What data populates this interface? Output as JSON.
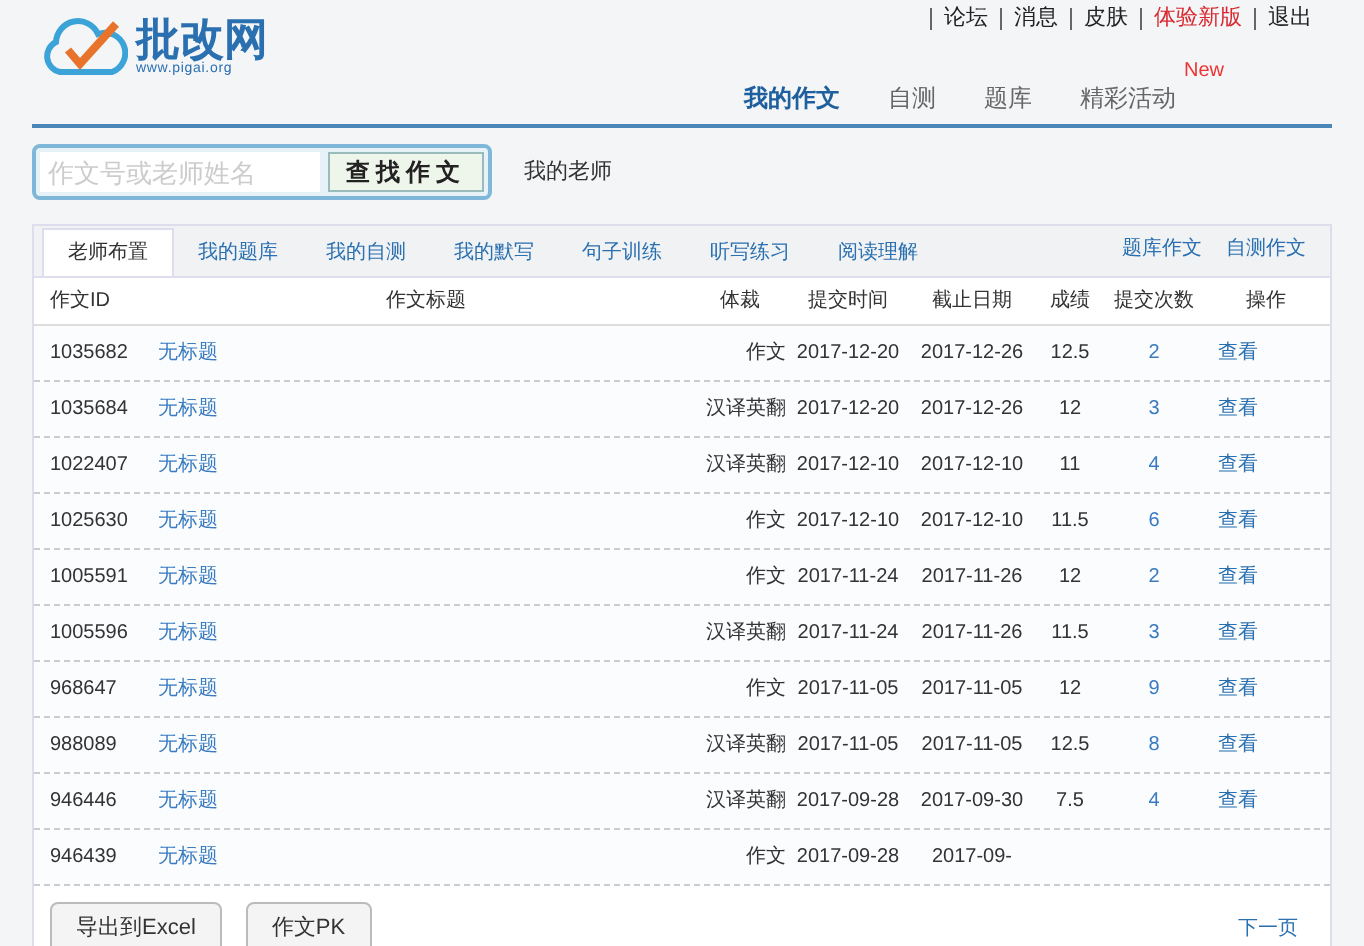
{
  "logo": {
    "name": "批改网",
    "url": "www.pigai.org"
  },
  "top_links": [
    {
      "label": "论坛",
      "kind": "normal"
    },
    {
      "label": "消息",
      "kind": "normal"
    },
    {
      "label": "皮肤",
      "kind": "normal"
    },
    {
      "label": "体验新版",
      "kind": "highlight"
    },
    {
      "label": "退出",
      "kind": "normal"
    }
  ],
  "nav": [
    {
      "label": "我的作文",
      "selected": true
    },
    {
      "label": "自测",
      "selected": false
    },
    {
      "label": "题库",
      "selected": false
    },
    {
      "label": "精彩活动",
      "selected": false,
      "badge": "New"
    }
  ],
  "search": {
    "placeholder": "作文号或老师姓名",
    "button": "查找作文"
  },
  "teacher_label": "我的老师",
  "tabs": [
    {
      "label": "老师布置",
      "selected": true
    },
    {
      "label": "我的题库",
      "selected": false
    },
    {
      "label": "我的自测",
      "selected": false
    },
    {
      "label": "我的默写",
      "selected": false
    },
    {
      "label": "句子训练",
      "selected": false
    },
    {
      "label": "听写练习",
      "selected": false
    },
    {
      "label": "阅读理解",
      "selected": false
    }
  ],
  "tab_links": [
    "题库作文",
    "自测作文"
  ],
  "table": {
    "columns": [
      "作文ID",
      "作文标题",
      "体裁",
      "提交时间",
      "截止日期",
      "成绩",
      "提交次数",
      "操作"
    ],
    "rows": [
      {
        "id": "1035682",
        "title": "无标题",
        "genre": "作文",
        "submitted": "2017-12-20",
        "deadline": "2017-12-26",
        "score": "12.5",
        "count": "2",
        "action": "查看"
      },
      {
        "id": "1035684",
        "title": "无标题",
        "genre": "汉译英翻",
        "submitted": "2017-12-20",
        "deadline": "2017-12-26",
        "score": "12",
        "count": "3",
        "action": "查看"
      },
      {
        "id": "1022407",
        "title": "无标题",
        "genre": "汉译英翻",
        "submitted": "2017-12-10",
        "deadline": "2017-12-10",
        "score": "11",
        "count": "4",
        "action": "查看"
      },
      {
        "id": "1025630",
        "title": "无标题",
        "genre": "作文",
        "submitted": "2017-12-10",
        "deadline": "2017-12-10",
        "score": "11.5",
        "count": "6",
        "action": "查看"
      },
      {
        "id": "1005591",
        "title": "无标题",
        "genre": "作文",
        "submitted": "2017-11-24",
        "deadline": "2017-11-26",
        "score": "12",
        "count": "2",
        "action": "查看"
      },
      {
        "id": "1005596",
        "title": "无标题",
        "genre": "汉译英翻",
        "submitted": "2017-11-24",
        "deadline": "2017-11-26",
        "score": "11.5",
        "count": "3",
        "action": "查看"
      },
      {
        "id": "968647",
        "title": "无标题",
        "genre": "作文",
        "submitted": "2017-11-05",
        "deadline": "2017-11-05",
        "score": "12",
        "count": "9",
        "action": "查看"
      },
      {
        "id": "988089",
        "title": "无标题",
        "genre": "汉译英翻",
        "submitted": "2017-11-05",
        "deadline": "2017-11-05",
        "score": "12.5",
        "count": "8",
        "action": "查看"
      },
      {
        "id": "946446",
        "title": "无标题",
        "genre": "汉译英翻",
        "submitted": "2017-09-28",
        "deadline": "2017-09-30",
        "score": "7.5",
        "count": "4",
        "action": "查看"
      },
      {
        "id": "946439",
        "title": "无标题",
        "genre": "作文",
        "submitted": "2017-09-28",
        "deadline": "2017-09-"
      }
    ]
  },
  "footer_buttons": [
    "导出到Excel",
    "作文PK"
  ],
  "pagination": {
    "next": "下一页"
  }
}
